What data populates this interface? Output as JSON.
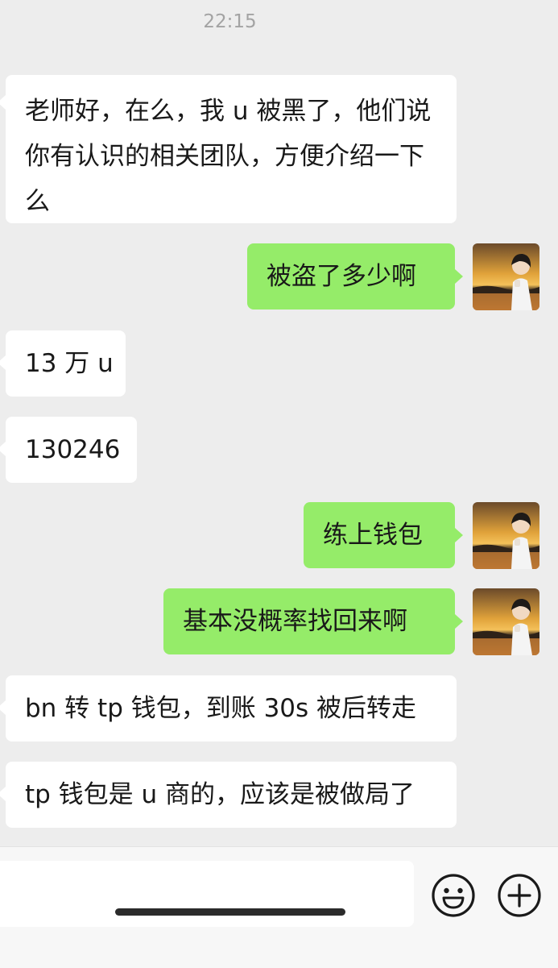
{
  "timestamp": "22:15",
  "messages": [
    {
      "side": "in",
      "text": "老师好，在么，我 u 被黑了，他们说你有认识的相关团队，方便介绍一下么"
    },
    {
      "side": "out",
      "text": "被盗了多少啊"
    },
    {
      "side": "in",
      "text": "13 万 u"
    },
    {
      "side": "in",
      "text": "130246"
    },
    {
      "side": "out",
      "text": "练上钱包"
    },
    {
      "side": "out",
      "text": "基本没概率找回来啊"
    },
    {
      "side": "in",
      "text": "bn 转 tp 钱包，到账 30s 被后转走"
    },
    {
      "side": "in",
      "text": "tp 钱包是 u 商的，应该是被做局了"
    }
  ],
  "input": {
    "value": "",
    "placeholder": ""
  },
  "icons": {
    "emoji": "smiley-face-icon",
    "more": "plus-circle-icon"
  },
  "colors": {
    "background": "#ededed",
    "incoming_bubble": "#ffffff",
    "outgoing_bubble": "#95ec69"
  }
}
